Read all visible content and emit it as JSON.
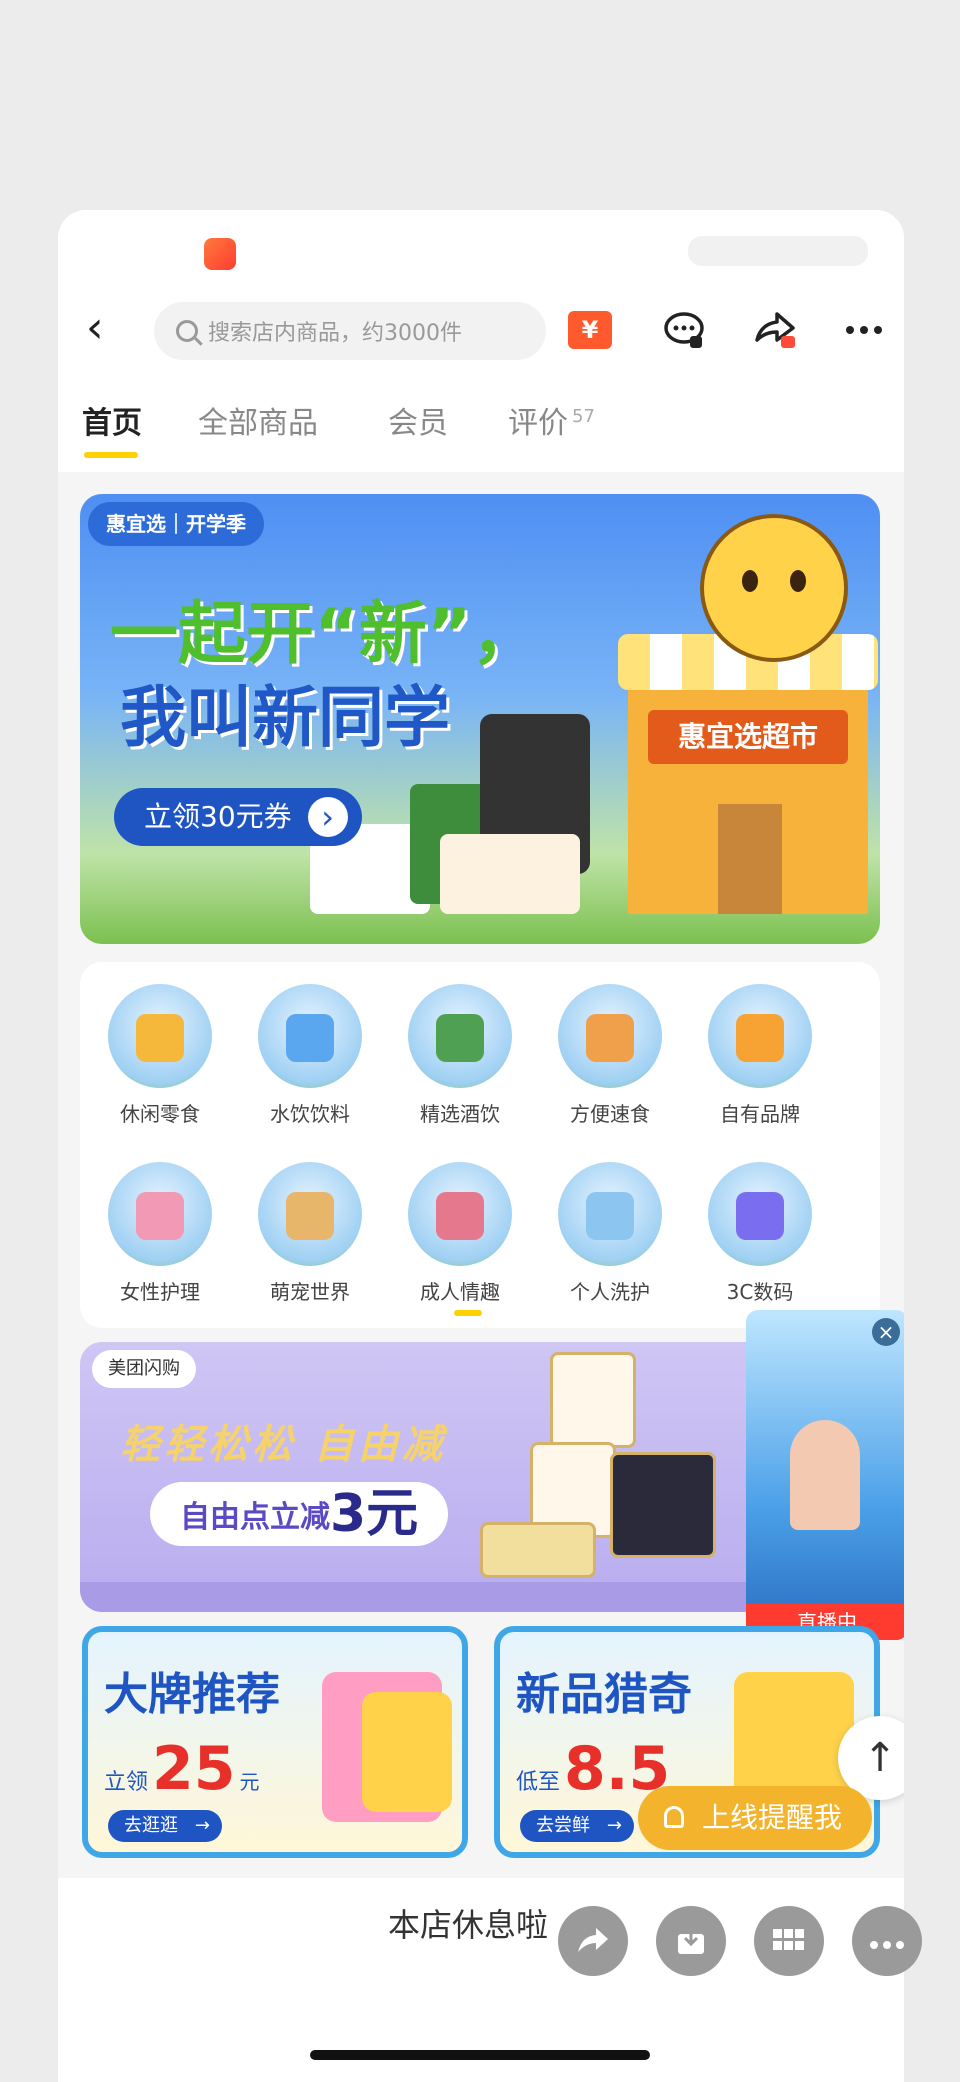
{
  "header": {
    "search_placeholder": "搜索店内商品，约3000件",
    "coupon_icon_label": "¥",
    "icons": [
      "back-icon",
      "search-icon",
      "coupon-icon",
      "message-icon",
      "share-icon",
      "more-icon"
    ]
  },
  "tabs": [
    {
      "label": "首页",
      "active": true
    },
    {
      "label": "全部商品"
    },
    {
      "label": "会员"
    },
    {
      "label": "评价",
      "count": "57"
    }
  ],
  "banner": {
    "tag": "惠宜选｜开学季",
    "line1": "一起开“新”，",
    "line2": "我叫新同学",
    "button": "立领30元券",
    "store_sign": "惠宜选超市"
  },
  "categories": [
    {
      "label": "休闲零食"
    },
    {
      "label": "水饮饮料"
    },
    {
      "label": "精选酒饮"
    },
    {
      "label": "方便速食"
    },
    {
      "label": "自有品牌"
    },
    {
      "label": "女性护理"
    },
    {
      "label": "萌宠世界"
    },
    {
      "label": "成人情趣"
    },
    {
      "label": "个人洗护"
    },
    {
      "label": "3C数码"
    }
  ],
  "promo": {
    "tag": "美团闪购",
    "script": "轻轻松松 自由减",
    "chip_prefix": "自由点立减",
    "chip_amount": "3元"
  },
  "live": {
    "badge": "直播中",
    "close": "×"
  },
  "cards": [
    {
      "title": "大牌推荐",
      "price_prefix": "立领",
      "price": "25",
      "unit": "元",
      "button": "去逛逛"
    },
    {
      "title": "新品猎奇",
      "price_prefix": "低至",
      "price": "8.5",
      "unit": "",
      "button": "去尝鲜"
    }
  ],
  "notify_label": "上线提醒我",
  "totop_label": "↑",
  "closed_text": "本店休息啦",
  "colors": {
    "accent": "#ffd100",
    "brand_blue": "#1f55c3",
    "notify": "#f4b32c",
    "live": "#ff3b30"
  }
}
